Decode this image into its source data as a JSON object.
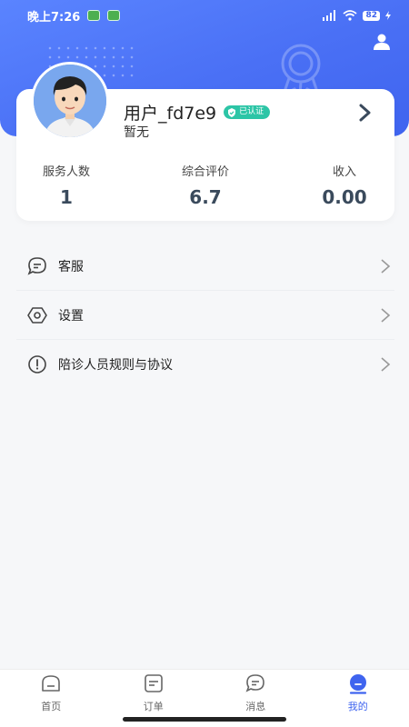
{
  "status_bar": {
    "time": "晚上7:26",
    "battery": "82"
  },
  "profile": {
    "username": "用户_fd7e9",
    "verified_label": "已认证",
    "subtitle": "暂无"
  },
  "stats": [
    {
      "label": "服务人数",
      "value": "1"
    },
    {
      "label": "综合评价",
      "value": "6.7"
    },
    {
      "label": "收入",
      "value": "0.00"
    }
  ],
  "menu": [
    {
      "label": "客服",
      "icon": "chat-bubble-icon"
    },
    {
      "label": "设置",
      "icon": "settings-hexagon-icon"
    },
    {
      "label": "陪诊人员规则与协议",
      "icon": "info-alert-icon"
    }
  ],
  "tabs": [
    {
      "label": "首页",
      "icon": "home-icon",
      "active": false
    },
    {
      "label": "订单",
      "icon": "order-icon",
      "active": false
    },
    {
      "label": "消息",
      "icon": "message-icon",
      "active": false
    },
    {
      "label": "我的",
      "icon": "profile-icon",
      "active": true
    }
  ],
  "colors": {
    "primary": "#3f64ef",
    "verified": "#2cc5a6",
    "background": "#f6f7f9"
  }
}
